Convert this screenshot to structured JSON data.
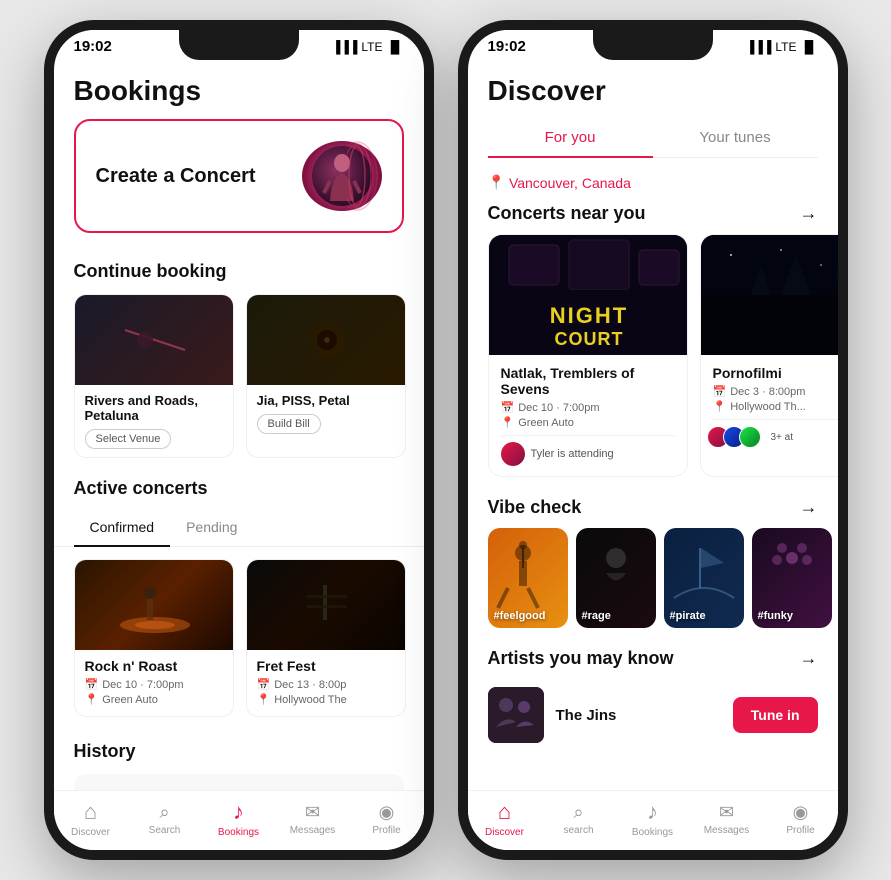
{
  "phone1": {
    "status": {
      "time": "19:02",
      "signal": "LTE"
    },
    "title": "Bookings",
    "create_concert": {
      "label": "Create a Concert"
    },
    "continue_booking": {
      "title": "Continue booking",
      "cards": [
        {
          "title": "Rivers and Roads, Petaluna",
          "chip": "Select Venue",
          "bg": "bg-rivers"
        },
        {
          "title": "Jia, PISS, Petal",
          "chip": "Build Bill",
          "bg": "bg-jia"
        }
      ]
    },
    "active_concerts": {
      "title": "Active concerts",
      "tabs": [
        "Confirmed",
        "Pending"
      ],
      "active_tab": "Confirmed",
      "cards": [
        {
          "title": "Rock n' Roast",
          "date": "Dec 10 · 7:00pm",
          "venue": "Green Auto",
          "bg": "bg-rock"
        },
        {
          "title": "Fret Fest",
          "date": "Dec 13 · 8:00p",
          "venue": "Hollywood The",
          "bg": "bg-fret"
        }
      ]
    },
    "history": {
      "title": "History"
    },
    "nav": [
      {
        "icon": "home",
        "label": "Discover",
        "active": false
      },
      {
        "icon": "search",
        "label": "Search",
        "active": false
      },
      {
        "icon": "bookmark",
        "label": "Bookings",
        "active": true
      },
      {
        "icon": "message",
        "label": "Messages",
        "active": false
      },
      {
        "icon": "person",
        "label": "Profile",
        "active": false
      }
    ]
  },
  "phone2": {
    "status": {
      "time": "19:02",
      "signal": "LTE"
    },
    "title": "Discover",
    "tabs": [
      "For you",
      "Your tunes"
    ],
    "active_tab": "For you",
    "location": "Vancouver, Canada",
    "concerts_near": {
      "title": "Concerts near you",
      "cards": [
        {
          "title": "Natlak, Tremblers of Sevens",
          "date": "Dec 10 · 7:00pm",
          "venue": "Green Auto",
          "attendee": "Tyler is attending",
          "type": "night-court"
        },
        {
          "title": "Pornofilmi",
          "date": "Dec 3 · 8:00pm",
          "venue": "Hollywood Th...",
          "attendee_count": "3+ at",
          "type": "pornofilmi"
        }
      ]
    },
    "vibe_check": {
      "title": "Vibe check",
      "items": [
        {
          "label": "#feelgood",
          "bg": "feelgood"
        },
        {
          "label": "#rage",
          "bg": "rage"
        },
        {
          "label": "#pirate",
          "bg": "pirate"
        },
        {
          "label": "#funky",
          "bg": "funky"
        }
      ]
    },
    "artists": {
      "title": "Artists you may know",
      "items": [
        {
          "name": "The Jins",
          "action": "Tune in"
        }
      ]
    },
    "nav": [
      {
        "icon": "home",
        "label": "Discover",
        "active": true
      },
      {
        "icon": "search",
        "label": "search",
        "active": false
      },
      {
        "icon": "bookmark",
        "label": "Bookings",
        "active": false
      },
      {
        "icon": "message",
        "label": "Messages",
        "active": false
      },
      {
        "icon": "person",
        "label": "Profile",
        "active": false
      }
    ]
  }
}
